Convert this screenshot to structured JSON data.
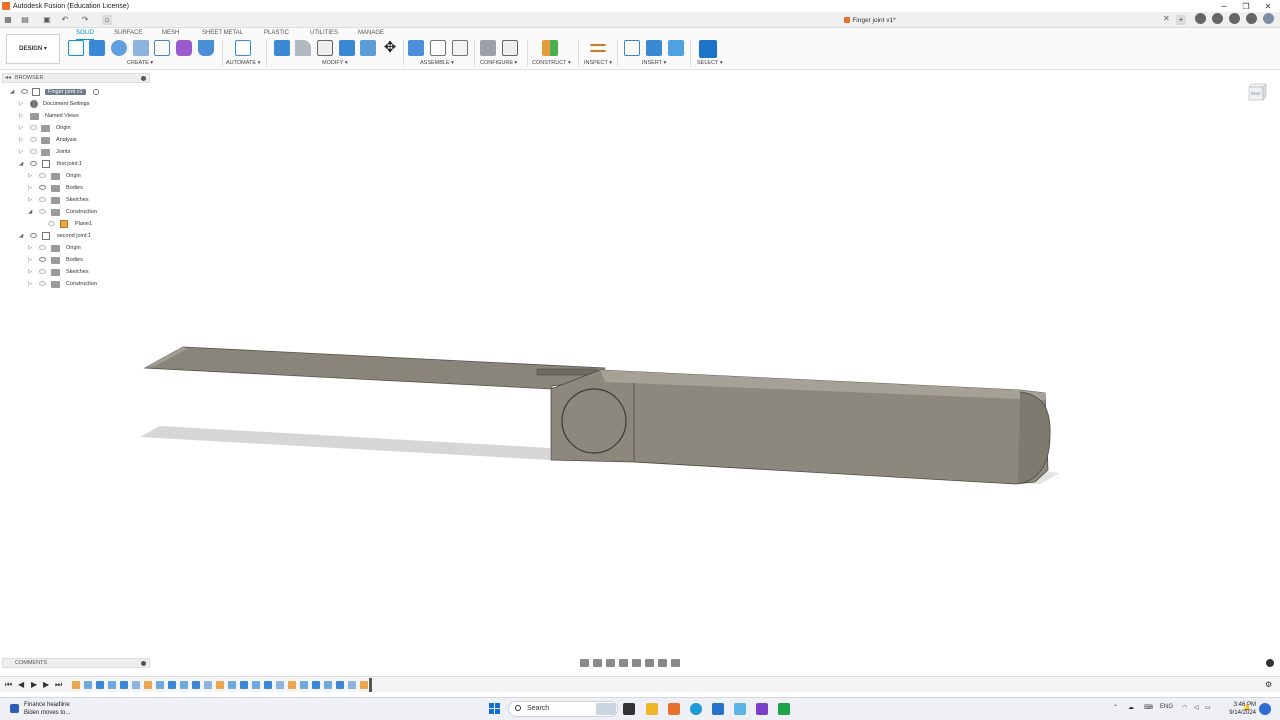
{
  "window": {
    "title": "Autodesk Fusion (Education License)"
  },
  "document": {
    "tab_title": "Finger joint v1*"
  },
  "workspace": {
    "label": "DESIGN ▾"
  },
  "tabs": [
    "SOLID",
    "SURFACE",
    "MESH",
    "SHEET METAL",
    "PLASTIC",
    "UTILITIES",
    "MANAGE"
  ],
  "toolbar_groups": [
    "CREATE ▾",
    "AUTOMATE ▾",
    "MODIFY ▾",
    "ASSEMBLE ▾",
    "CONFIGURE ▾",
    "CONSTRUCT ▾",
    "INSPECT ▾",
    "INSERT ▾",
    "SELECT ▾"
  ],
  "browser": {
    "title": "BROWSER",
    "root": "Finger joint v1",
    "items": [
      {
        "label": "Document Settings",
        "icon": "gear-icon"
      },
      {
        "label": "Named Views",
        "icon": "folder-icon"
      },
      {
        "label": "Origin",
        "icon": "folder-icon"
      },
      {
        "label": "Analysis",
        "icon": "folder-icon"
      },
      {
        "label": "Joints",
        "icon": "folder-icon"
      },
      {
        "label": "first joint:1",
        "icon": "component-icon"
      },
      {
        "label": "Origin",
        "icon": "folder-icon"
      },
      {
        "label": "Bodies",
        "icon": "folder-icon"
      },
      {
        "label": "Sketches",
        "icon": "folder-icon"
      },
      {
        "label": "Construction",
        "icon": "folder-icon"
      },
      {
        "label": "Plane1",
        "icon": "plane-icon"
      },
      {
        "label": "second joint:1",
        "icon": "component-icon"
      },
      {
        "label": "Origin",
        "icon": "folder-icon"
      },
      {
        "label": "Bodies",
        "icon": "folder-icon"
      },
      {
        "label": "Sketches",
        "icon": "folder-icon"
      },
      {
        "label": "Construction",
        "icon": "folder-icon"
      }
    ]
  },
  "viewcube": {
    "face": "RIGHT"
  },
  "comments": {
    "title": "COMMENTS"
  },
  "taskbar": {
    "news_title": "Finance headline",
    "news_sub": "Biden moves to...",
    "search_placeholder": "Search",
    "lang": "ENG",
    "time": "3:46 PM",
    "date": "9/14/2024"
  },
  "colors": {
    "accent": "#0696d7",
    "model": "#8a857a",
    "brand": "#e8702a"
  }
}
